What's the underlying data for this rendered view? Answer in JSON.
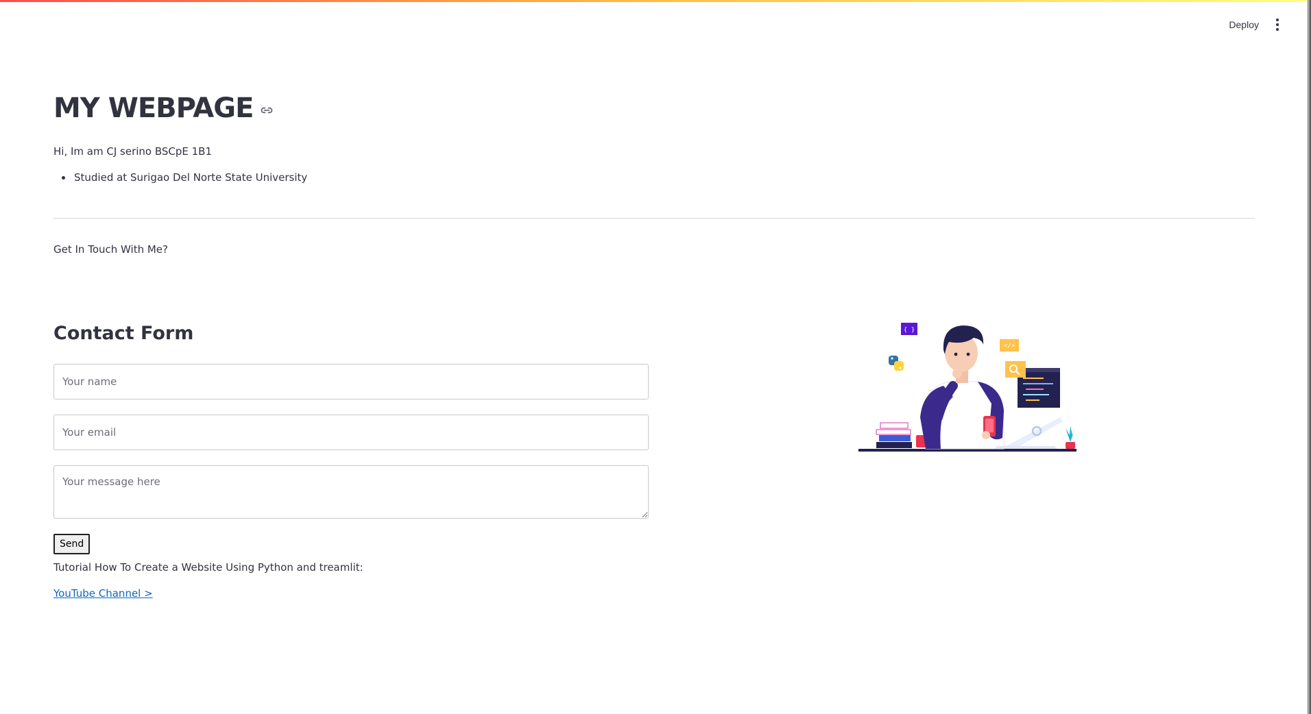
{
  "toolbar": {
    "deploy_label": "Deploy",
    "menu_icon": "kebab-menu-icon"
  },
  "header": {
    "title": "MY WEBPAGE",
    "anchor_icon": "link-icon"
  },
  "intro": {
    "text": "Hi, Im am CJ serino BSCpE 1B1",
    "bullets": [
      "Studied at Surigao Del Norte State University"
    ]
  },
  "contact_prompt": "Get In Touch With Me?",
  "contact_form": {
    "title": "Contact Form",
    "name_placeholder": "Your name",
    "email_placeholder": "Your email",
    "message_placeholder": "Your message here",
    "send_label": "Send"
  },
  "tutorial": {
    "text": "Tutorial How To Create a Website Using Python and treamlit:",
    "link_label": "YouTube Channel >"
  },
  "illustration": {
    "icon": "developer-illustration",
    "badge_braces": "{ }",
    "badge_code": "</>"
  },
  "colors": {
    "accent_start": "#ff4b4b",
    "accent_end": "#fffd80",
    "text": "#31333f",
    "link": "#0b66c2",
    "illustration_purple": "#3b2a8c",
    "illustration_red": "#e8344e"
  }
}
